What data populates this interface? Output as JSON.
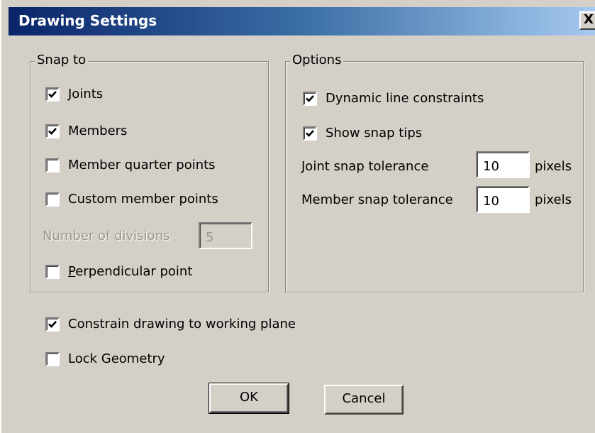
{
  "window": {
    "title": "Drawing Settings",
    "close_label": "X"
  },
  "snap_to": {
    "legend": "Snap to",
    "items": [
      {
        "label": "Joints",
        "checked": true
      },
      {
        "label": "Members",
        "checked": true
      },
      {
        "label": "Member quarter points",
        "checked": false
      },
      {
        "label": "Custom member points",
        "checked": false
      }
    ],
    "divisions_label": "Number of divisions",
    "divisions_value": "5",
    "perpendicular": {
      "label_prefix": "P",
      "label_rest": "erpendicular point",
      "checked": false
    }
  },
  "options": {
    "legend": "Options",
    "items": [
      {
        "label": "Dynamic line constraints",
        "checked": true
      },
      {
        "label": "Show snap tips",
        "checked": true
      }
    ],
    "joint_tolerance_label": "Joint snap tolerance",
    "joint_tolerance_value": "10",
    "member_tolerance_label": "Member snap tolerance",
    "member_tolerance_value": "10",
    "unit": "pixels"
  },
  "constrain": {
    "label": "Constrain drawing to working plane",
    "checked": true
  },
  "lock_geometry": {
    "label": "Lock Geometry",
    "checked": false
  },
  "buttons": {
    "ok": "OK",
    "cancel": "Cancel"
  }
}
